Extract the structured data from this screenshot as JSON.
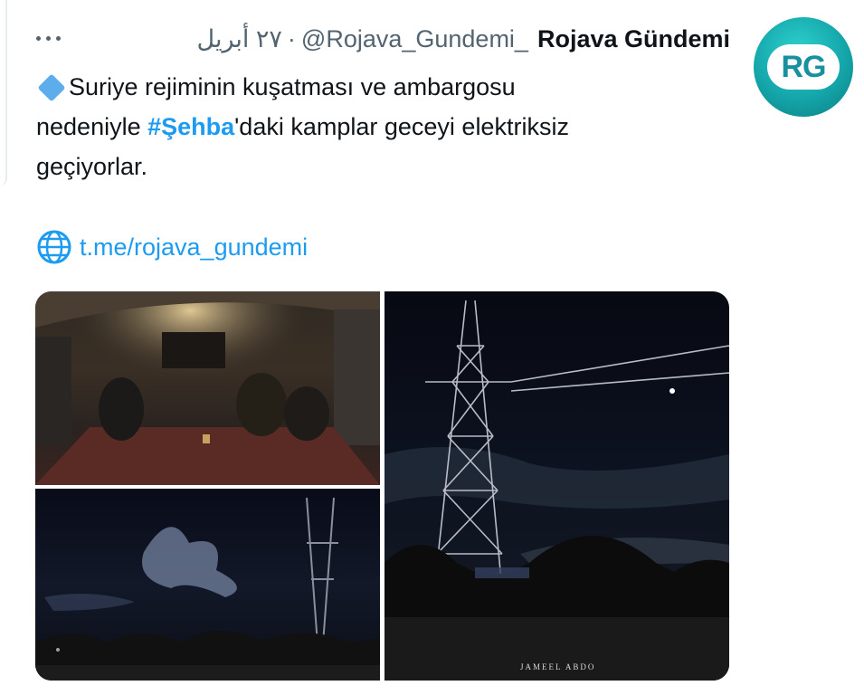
{
  "tweet": {
    "author_name": "Rojava Gündemi",
    "author_handle": "@Rojava_Gundemi_",
    "separator": "·",
    "date": "٢٧ أبريل",
    "avatar_text": "RG",
    "text": {
      "line1": "Suriye rejiminin kuşatması ve ambargosu",
      "line2_before": "nedeniyle ",
      "hashtag": "#Şehba",
      "line2_after": "'daki kamplar geceyi elektriksiz",
      "line3": "geçiyorlar."
    },
    "link": "t.me/rojava_gundemi",
    "photo_caption": "JAMEEL ABDO"
  },
  "colors": {
    "link": "#1d9bf0",
    "secondary_text": "#536471",
    "avatar": "#14a6aa"
  },
  "icons": [
    "more-options-icon",
    "diamond-emoji-icon",
    "globe-icon"
  ]
}
